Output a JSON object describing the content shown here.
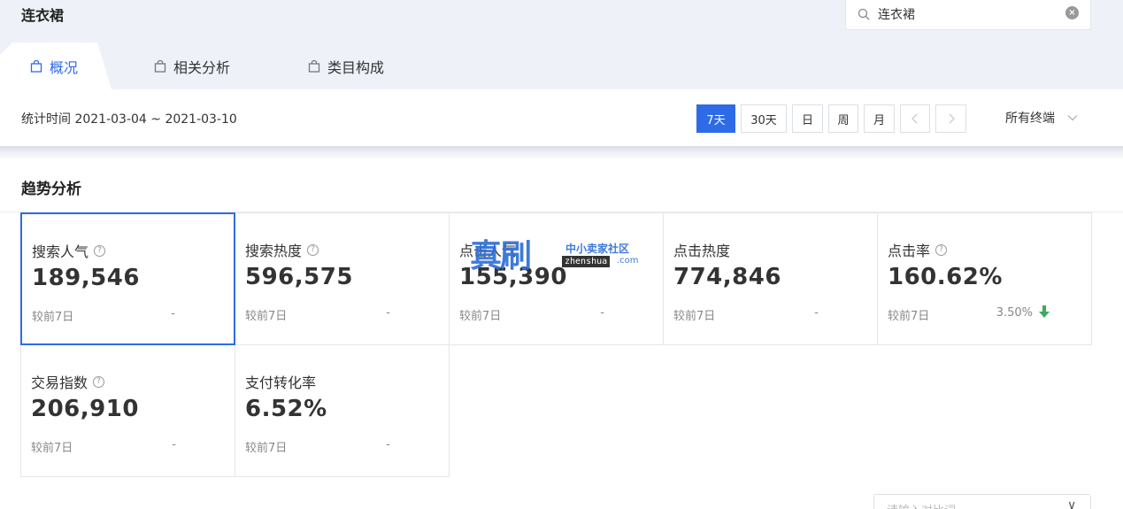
{
  "header": {
    "title": "连衣裙",
    "search": {
      "value": "连衣裙",
      "clear_icon": "clear-circle-icon"
    }
  },
  "tabs": [
    {
      "label": "概况",
      "active": true,
      "icon": "shopping-bag-icon"
    },
    {
      "label": "相关分析",
      "active": false,
      "icon": "shopping-bag-icon"
    },
    {
      "label": "类目构成",
      "active": false,
      "icon": "shopping-bag-icon"
    }
  ],
  "filter": {
    "stat_time": "统计时间 2021-03-04 ~ 2021-03-10",
    "periods": [
      "7天",
      "30天",
      "日",
      "周",
      "月"
    ],
    "active_period": "7天",
    "terminal": "所有终端"
  },
  "section": {
    "title": "趋势分析"
  },
  "metrics": [
    {
      "label": "搜索人气",
      "help": "?",
      "value": "189,546",
      "compare_label": "较前7日",
      "compare_value": "-"
    },
    {
      "label": "搜索热度",
      "help": "?",
      "value": "596,575",
      "compare_label": "较前7日",
      "compare_value": "-"
    },
    {
      "label": "点击人气",
      "help": "",
      "value": "155,390",
      "compare_label": "较前7日",
      "compare_value": "-"
    },
    {
      "label": "点击热度",
      "help": "",
      "value": "774,846",
      "compare_label": "较前7日",
      "compare_value": "-"
    },
    {
      "label": "点击率",
      "help": "?",
      "value": "160.62%",
      "compare_label": "较前7日",
      "compare_value": "3.50%",
      "trend": "down"
    },
    {
      "label": "交易指数",
      "help": "?",
      "value": "206,910",
      "compare_label": "较前7日",
      "compare_value": "-"
    },
    {
      "label": "支付转化率",
      "help": "",
      "value": "6.52%",
      "compare_label": "较前7日",
      "compare_value": "-"
    }
  ],
  "watermark": {
    "big": "真刷",
    "small": "中小卖家社区",
    "url": "zhenshua",
    "suffix": ".com"
  },
  "colors": {
    "accent": "#2e6be6",
    "down": "#3daa5c",
    "topbar_bg": "#eef1f8"
  },
  "bottom_input": {
    "placeholder": "请输入对比词"
  }
}
